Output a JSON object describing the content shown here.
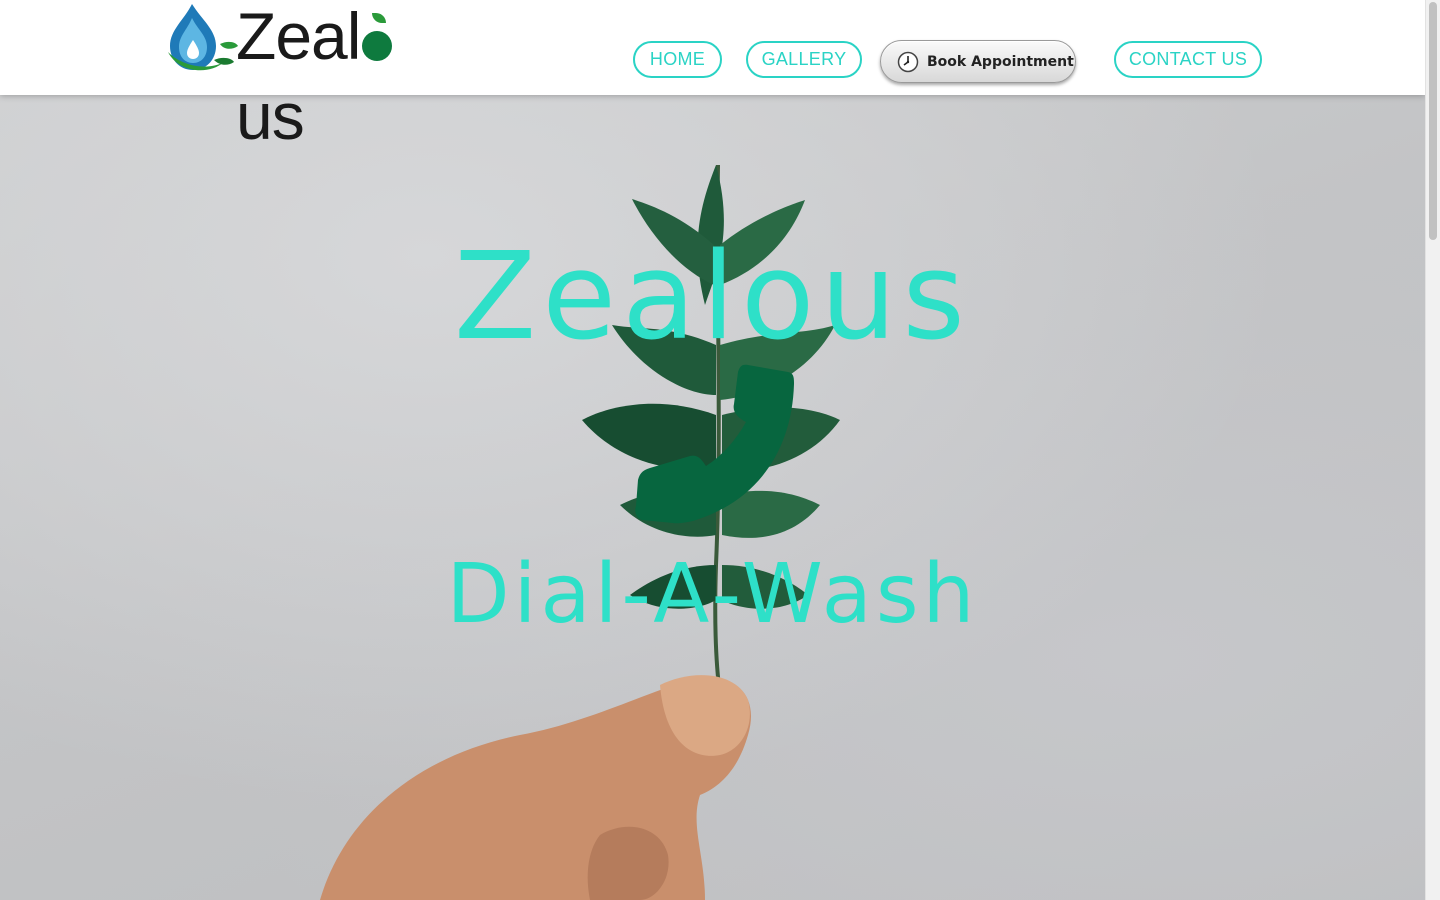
{
  "header": {
    "logo_text_before": "Zeal",
    "logo_text_after": "us",
    "nav": {
      "home_label": "HOME",
      "gallery_label": "GALLERY",
      "book_label": "Book Appointment",
      "contact_label": "CONTACT US"
    }
  },
  "hero": {
    "title": "Zealous",
    "subtitle": "Dial-A-Wash",
    "icon": "phone-icon"
  },
  "colors": {
    "accent": "#2ad3c5",
    "hero_text": "#2ee0c8",
    "phone_icon": "#07663f",
    "logo_green": "#0e7a3e",
    "logo_blue": "#1f7ab8"
  },
  "icons": [
    "water-drop-logo-icon",
    "clock-icon",
    "phone-icon"
  ]
}
